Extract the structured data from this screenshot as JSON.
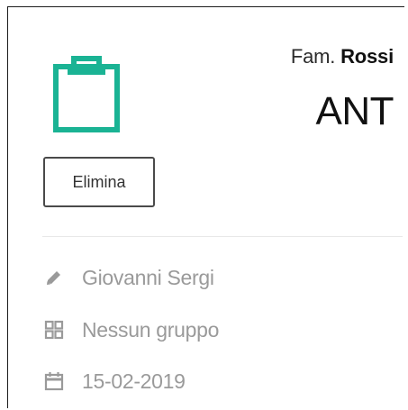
{
  "header": {
    "family_prefix": "Fam.",
    "family_surname": "Rossi",
    "code": "ANT"
  },
  "actions": {
    "delete_label": "Elimina"
  },
  "meta": {
    "author": "Giovanni Sergi",
    "group": "Nessun gruppo",
    "date": "15-02-2019"
  },
  "icons": {
    "main": "clipboard-icon",
    "author": "pencil-icon",
    "group": "grid-icon",
    "date": "calendar-icon"
  },
  "colors": {
    "accent": "#1ab394",
    "muted": "#9a9a9a",
    "text": "#111111"
  }
}
